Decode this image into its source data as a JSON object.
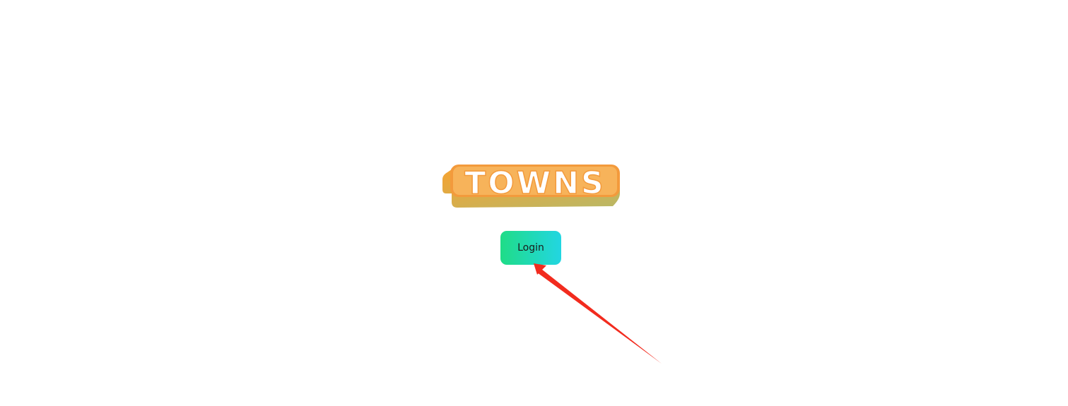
{
  "logo": {
    "text": "TOWNS",
    "colors": {
      "shadow_start": "#f5a332",
      "shadow_end": "#b9b866",
      "outline": "#f39a3c",
      "fill": "#ffffff"
    }
  },
  "login_button": {
    "label": "Login",
    "gradient": [
      "#1fdc87",
      "#22d6e2"
    ]
  },
  "annotation": {
    "type": "arrow",
    "color": "#f22b1e",
    "points_to": "login_button"
  }
}
